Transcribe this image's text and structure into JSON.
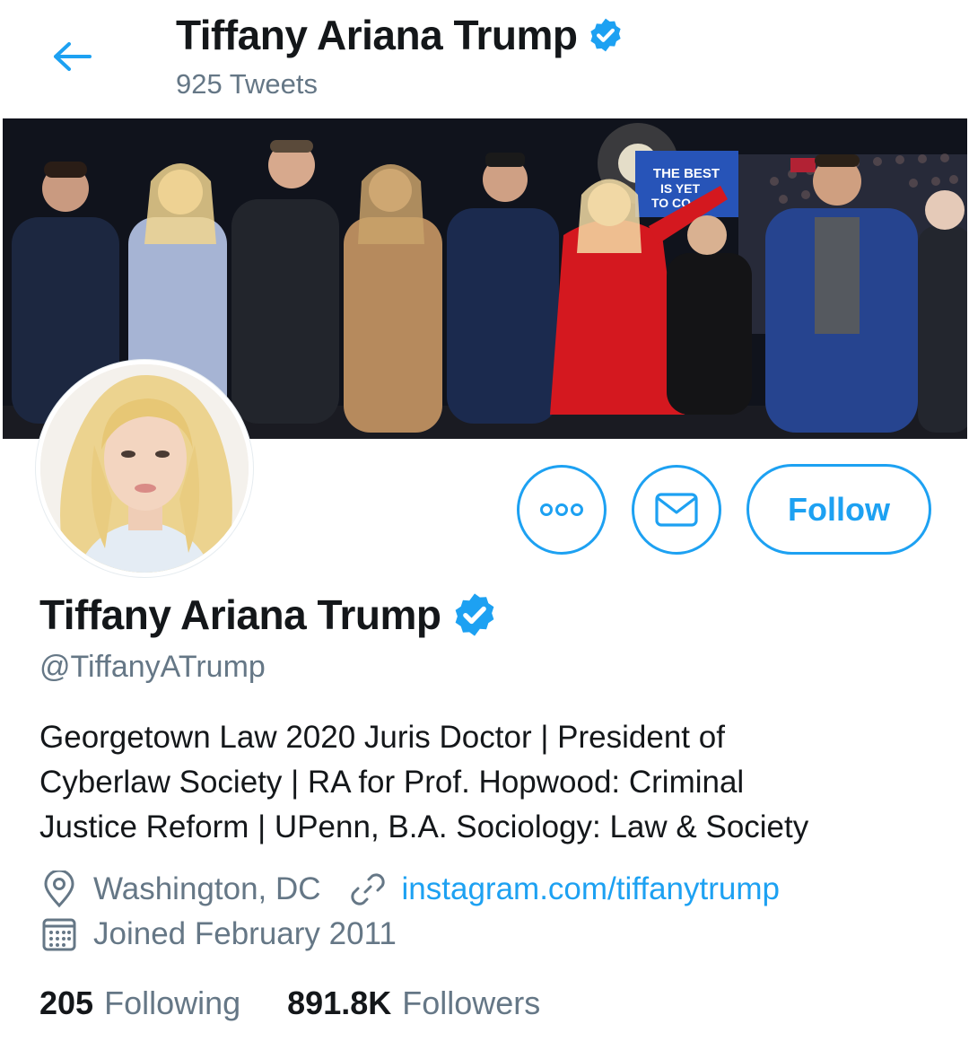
{
  "header": {
    "name": "Tiffany Ariana Trump",
    "tweet_count": "925 Tweets",
    "back_icon": "arrow-left-icon"
  },
  "banner": {
    "sign_lines": [
      "THE BEST",
      "IS YET",
      "TO CO"
    ]
  },
  "profile": {
    "name": "Tiffany Ariana Trump",
    "verified": true,
    "handle": "@TiffanyATrump",
    "bio_lines": [
      "Georgetown Law 2020 Juris Doctor | President of",
      "Cyberlaw Society | RA for Prof. Hopwood: Criminal",
      "Justice Reform | UPenn, B.A. Sociology: Law & Society"
    ],
    "location": "Washington, DC",
    "website": "instagram.com/tiffanytrump",
    "joined": "Joined February 2011"
  },
  "actions": {
    "follow_label": "Follow",
    "more_icon": "more-options-icon",
    "message_icon": "envelope-icon"
  },
  "stats": {
    "following_count": "205",
    "following_label": "Following",
    "followers_count": "891.8K",
    "followers_label": "Followers"
  },
  "colors": {
    "accent": "#1da1f2",
    "secondary_text": "#657786",
    "primary_text": "#14171a",
    "verified": "#1da1f2"
  }
}
